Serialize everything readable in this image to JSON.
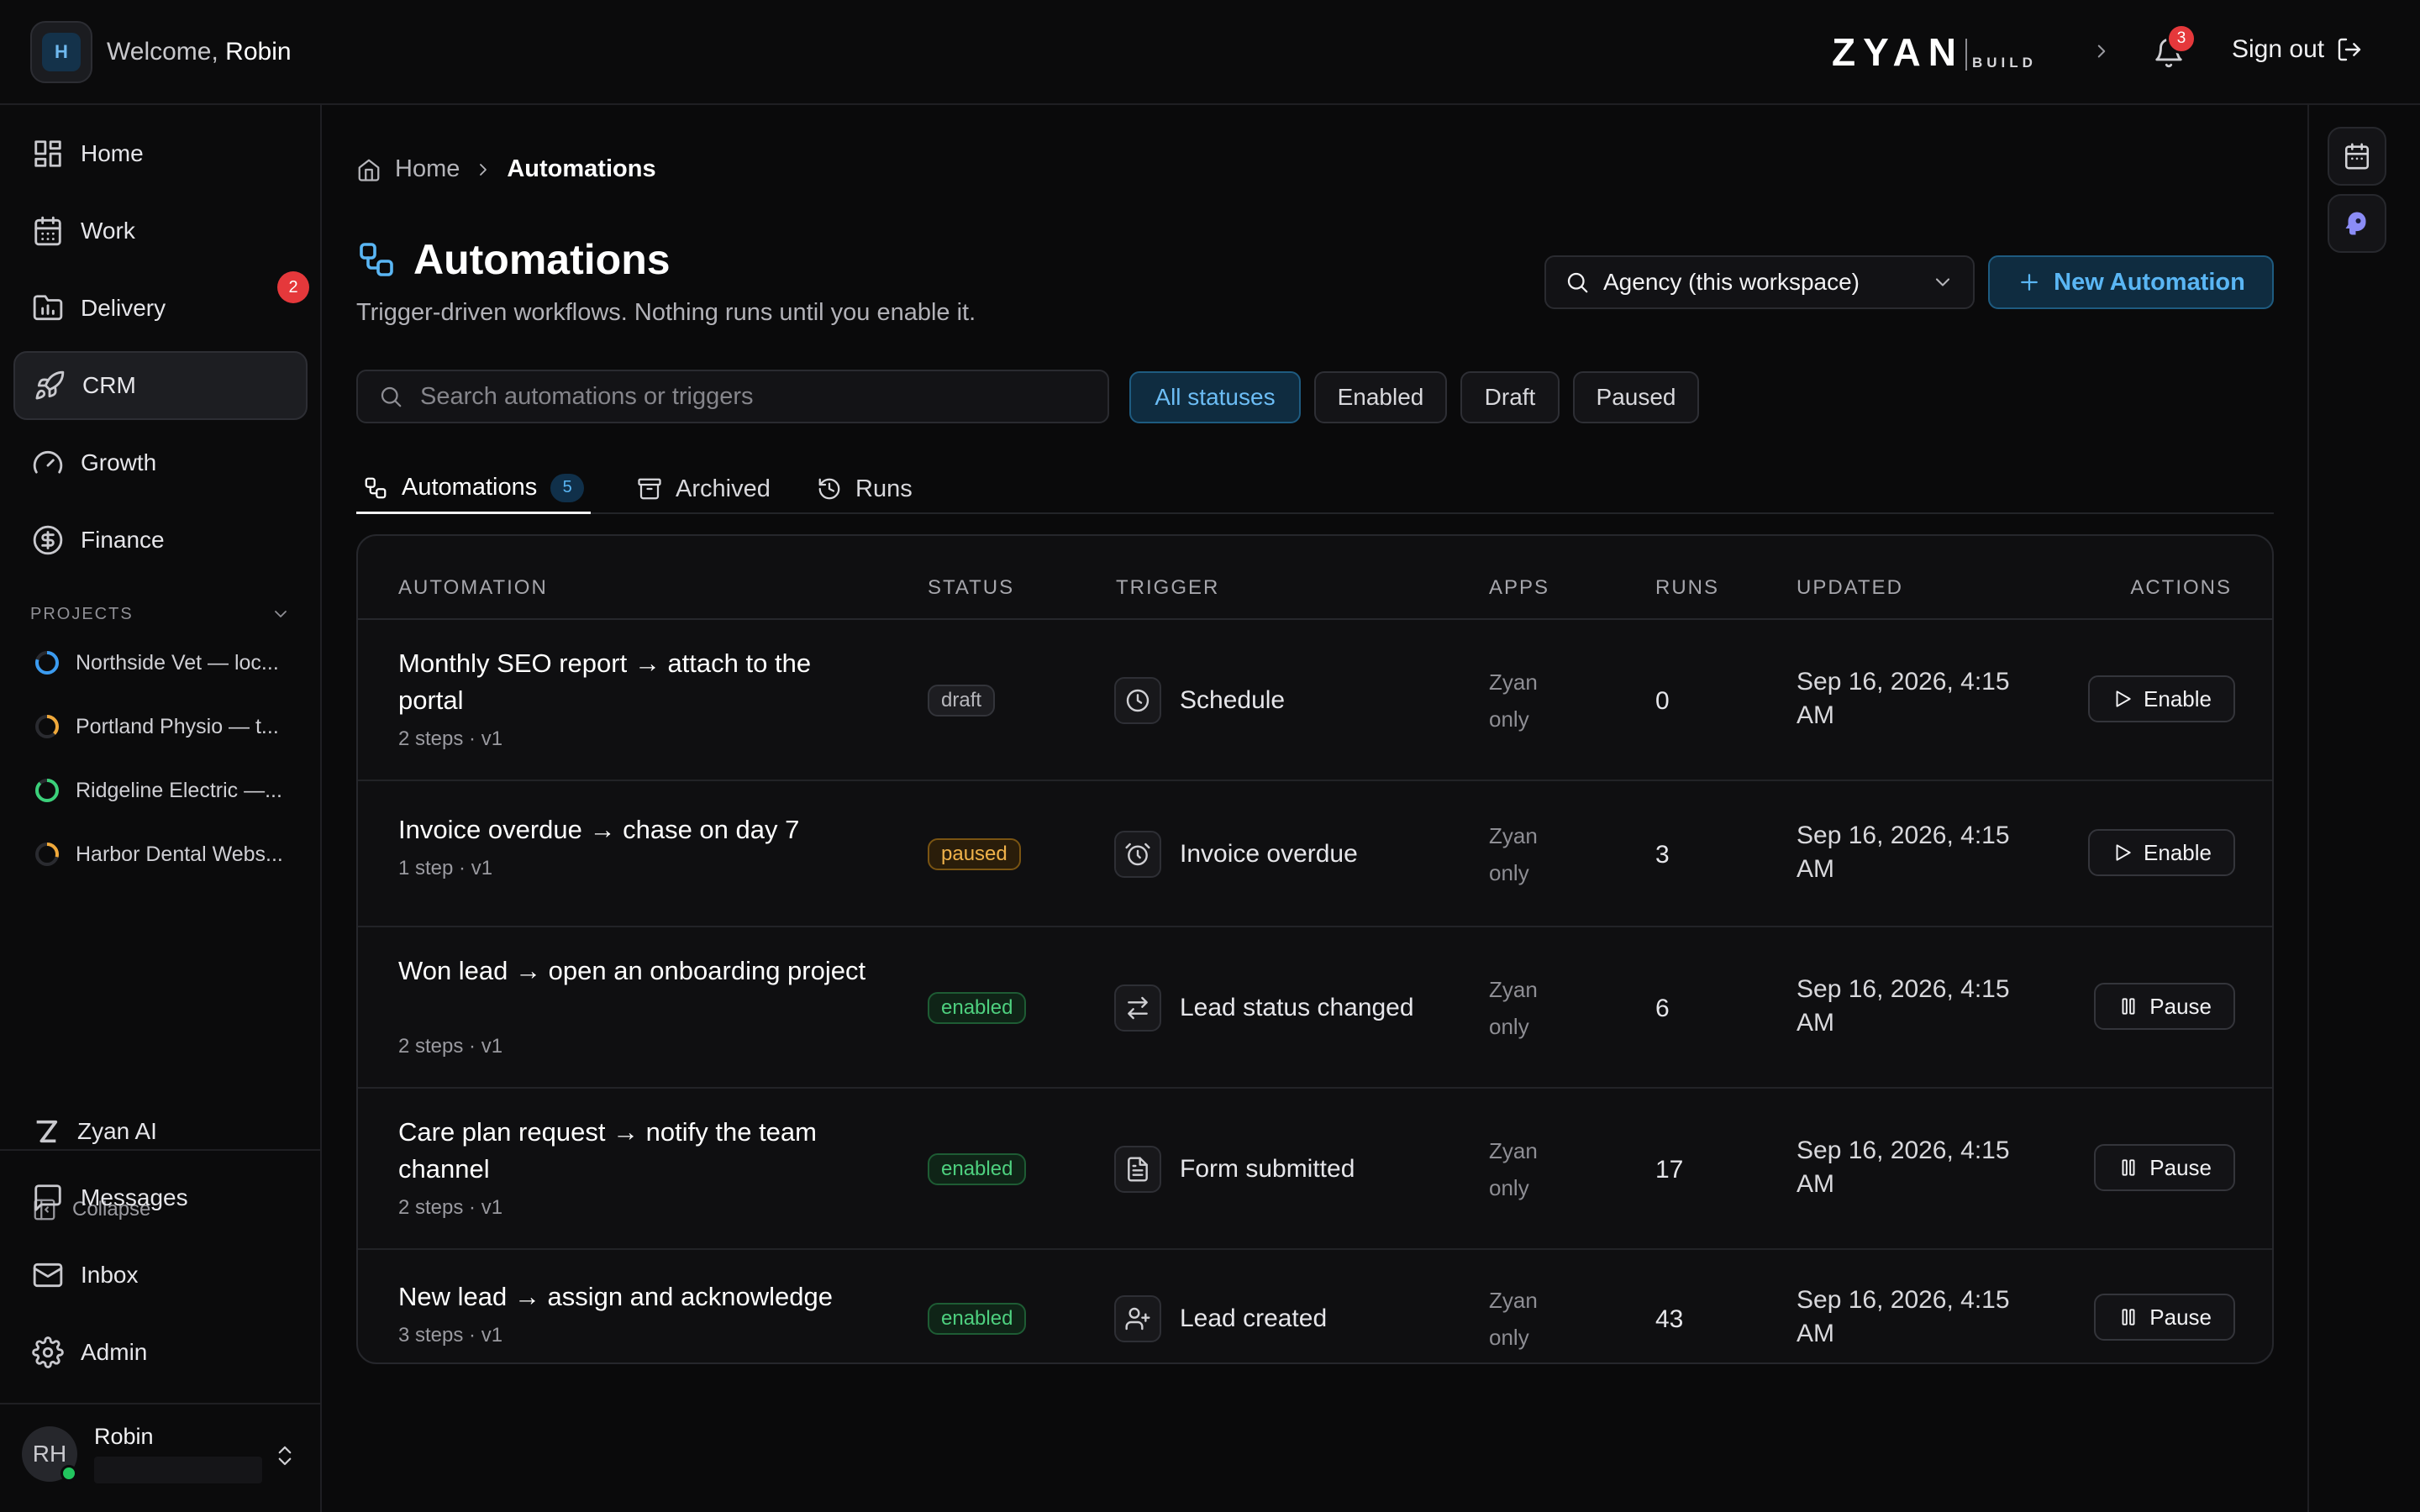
{
  "topbar": {
    "workspace_initial": "H",
    "welcome_prefix": "Welcome,",
    "user_first_name": "Robin",
    "brand_name": "ZYAN",
    "brand_sub": "BUILD",
    "notification_count": "3",
    "sign_out_label": "Sign out"
  },
  "sidebar": {
    "nav": [
      {
        "label": "Home",
        "icon": "dashboard-icon"
      },
      {
        "label": "Work",
        "icon": "calendar-icon"
      },
      {
        "label": "Delivery",
        "icon": "folder-icon",
        "badge": "2"
      },
      {
        "label": "CRM",
        "icon": "rocket-icon",
        "active": true
      },
      {
        "label": "Growth",
        "icon": "gauge-icon"
      },
      {
        "label": "Finance",
        "icon": "dollar-circle-icon"
      }
    ],
    "projects_heading": "PROJECTS",
    "projects": [
      {
        "label": "Northside Vet — loc...",
        "color": "#3b9bf0"
      },
      {
        "label": "Portland Physio — t...",
        "color": "#f0a93b"
      },
      {
        "label": "Ridgeline Electric —...",
        "color": "#3bd07a"
      },
      {
        "label": "Harbor Dental Webs...",
        "color": "#f0a93b"
      }
    ],
    "zyan_ai_label": "Zyan AI",
    "collapse_label": "Collapse",
    "bottom_nav": [
      {
        "label": "Messages",
        "icon": "message-icon"
      },
      {
        "label": "Inbox",
        "icon": "mail-icon"
      },
      {
        "label": "Admin",
        "icon": "gear-icon"
      }
    ],
    "user": {
      "initials": "RH",
      "name": "Robin",
      "status_color": "#22c55e"
    }
  },
  "breadcrumb": {
    "home": "Home",
    "current": "Automations"
  },
  "page": {
    "title": "Automations",
    "subtitle": "Trigger-driven workflows. Nothing runs until you enable it.",
    "scope_select": "Agency (this workspace)",
    "new_button": "New Automation",
    "search_placeholder": "Search automations or triggers",
    "filters": [
      "All statuses",
      "Enabled",
      "Draft",
      "Paused"
    ],
    "active_filter": "All statuses"
  },
  "tabs": [
    {
      "label": "Automations",
      "count": "5",
      "icon": "workflow-icon"
    },
    {
      "label": "Archived",
      "icon": "archive-icon"
    },
    {
      "label": "Runs",
      "icon": "history-icon"
    }
  ],
  "table": {
    "headers": [
      "AUTOMATION",
      "STATUS",
      "TRIGGER",
      "APPS",
      "RUNS",
      "UPDATED",
      "ACTIONS"
    ],
    "rows": [
      {
        "name": "Monthly SEO report → attach to the portal",
        "meta": "2 steps · v1",
        "status": "draft",
        "trigger": "Schedule",
        "trigger_icon": "clock-icon",
        "apps": "Zyan only",
        "runs": "0",
        "updated": "Sep 16, 2026, 4:15 AM",
        "action": "Enable"
      },
      {
        "name": "Invoice overdue → chase on day 7",
        "meta": "1 step · v1",
        "status": "paused",
        "trigger": "Invoice overdue",
        "trigger_icon": "alarm-icon",
        "apps": "Zyan only",
        "runs": "3",
        "updated": "Sep 16, 2026, 4:15 AM",
        "action": "Enable"
      },
      {
        "name": "Won lead → open an onboarding project",
        "meta": "2 steps · v1",
        "status": "enabled",
        "trigger": "Lead status changed",
        "trigger_icon": "swap-icon",
        "apps": "Zyan only",
        "runs": "6",
        "updated": "Sep 16, 2026, 4:15 AM",
        "action": "Pause"
      },
      {
        "name": "Care plan request → notify the team channel",
        "meta": "2 steps · v1",
        "status": "enabled",
        "trigger": "Form submitted",
        "trigger_icon": "document-icon",
        "apps": "Zyan only",
        "runs": "17",
        "updated": "Sep 16, 2026, 4:15 AM",
        "action": "Pause"
      },
      {
        "name": "New lead → assign and acknowledge",
        "meta": "3 steps · v1",
        "status": "enabled",
        "trigger": "Lead created",
        "trigger_icon": "user-plus-icon",
        "apps": "Zyan only",
        "runs": "43",
        "updated": "Sep 16, 2026, 4:15 AM",
        "action": "Pause"
      }
    ]
  }
}
